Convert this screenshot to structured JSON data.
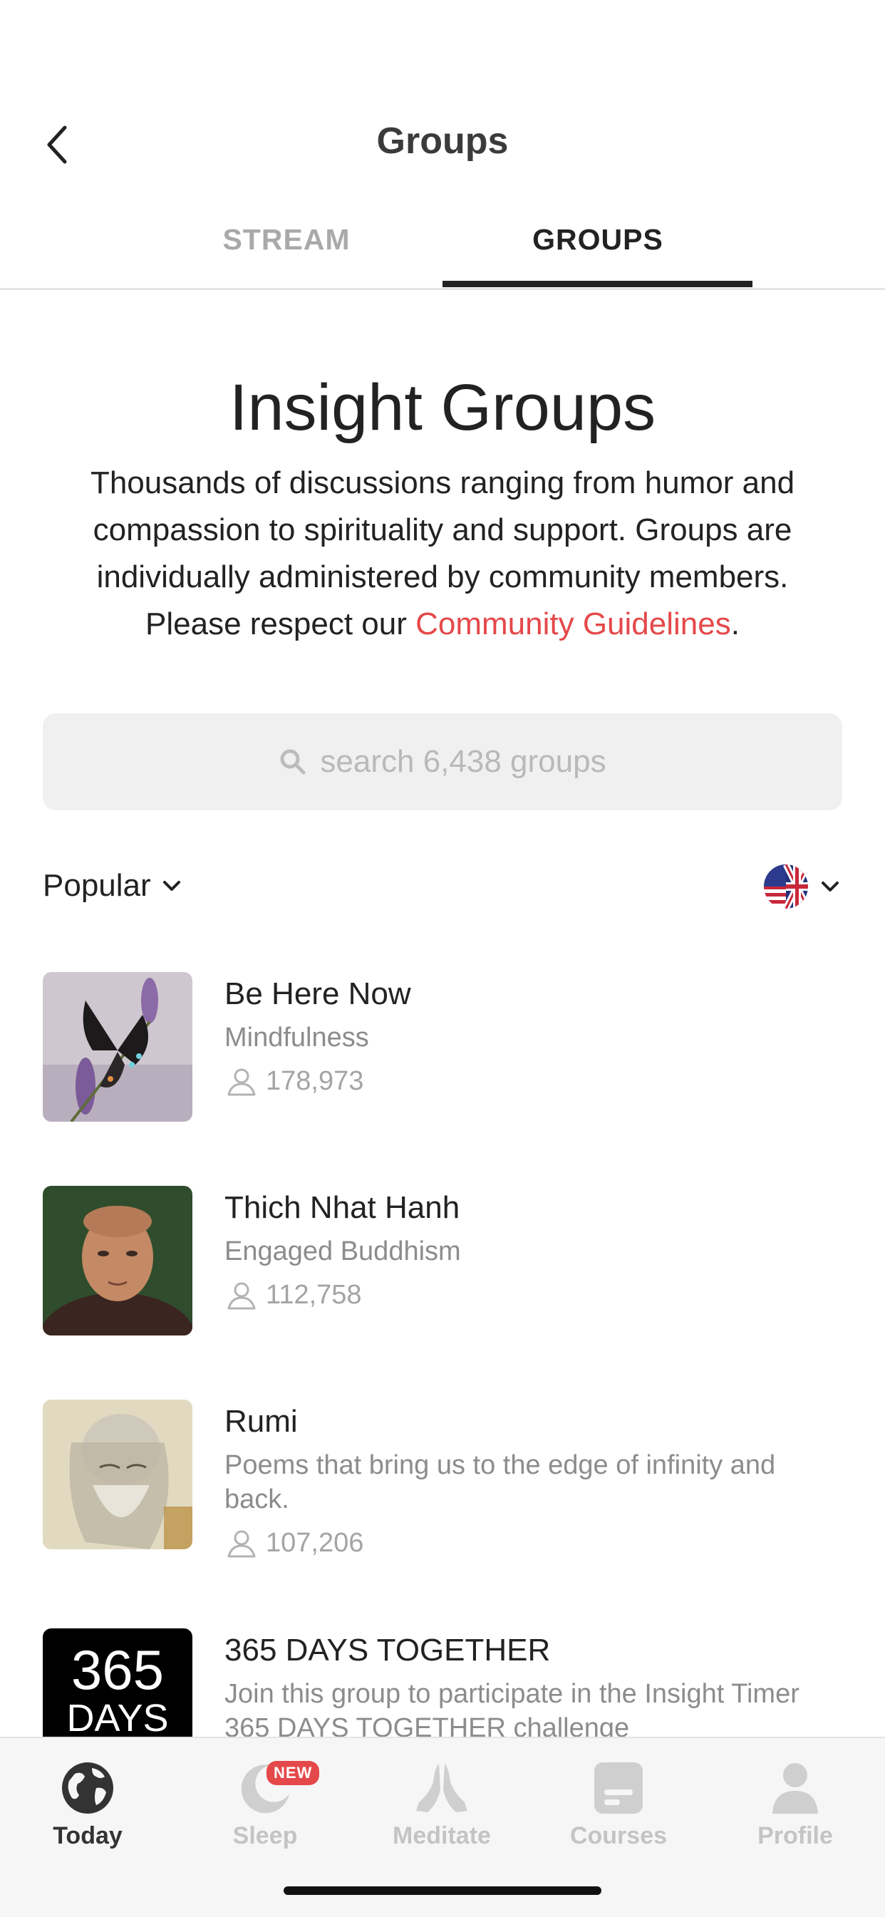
{
  "header": {
    "title": "Groups",
    "tabs": [
      {
        "label": "STREAM",
        "active": false
      },
      {
        "label": "GROUPS",
        "active": true
      }
    ]
  },
  "hero": {
    "title": "Insight Groups",
    "description_before": "Thousands of discussions ranging from humor and compassion to spirituality and support. Groups are individually administered by community members. Please respect our ",
    "link_label": "Community Guidelines",
    "description_after": "."
  },
  "search": {
    "placeholder": "search 6,438 groups"
  },
  "filter": {
    "sort_label": "Popular",
    "language_icon": "us-uk-flag-icon"
  },
  "groups": [
    {
      "name": "Be Here Now",
      "category": "Mindfulness",
      "members": "178,973",
      "image": "butterfly-photo"
    },
    {
      "name": "Thich Nhat Hanh",
      "category": "Engaged Buddhism",
      "members": "112,758",
      "image": "monk-portrait"
    },
    {
      "name": "Rumi",
      "category": "Poems that bring us to the edge of infinity and back.",
      "members": "107,206",
      "image": "rumi-drawing"
    },
    {
      "name": "365 DAYS TOGETHER",
      "category": "Join this group to participate in the Insight Timer 365 DAYS TOGETHER challenge",
      "members": "",
      "image": "365-days-logo",
      "thumb_line1": "365",
      "thumb_line2": "DAYS"
    }
  ],
  "nav": {
    "items": [
      {
        "label": "Today",
        "icon": "globe-icon",
        "active": true
      },
      {
        "label": "Sleep",
        "icon": "moon-icon",
        "active": false,
        "badge": "NEW"
      },
      {
        "label": "Meditate",
        "icon": "praying-hands-icon",
        "active": false
      },
      {
        "label": "Courses",
        "icon": "course-card-icon",
        "active": false
      },
      {
        "label": "Profile",
        "icon": "person-icon",
        "active": false
      }
    ]
  },
  "colors": {
    "accent": "#e5484a",
    "text": "#222222",
    "muted": "#8c8c8c"
  }
}
